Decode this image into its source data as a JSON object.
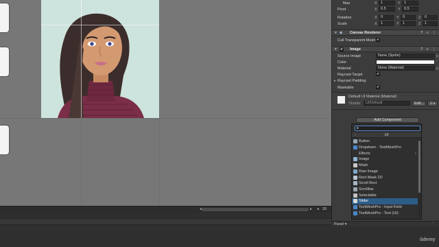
{
  "inspector": {
    "transform": {
      "max_label": "Max",
      "max_x_label": "X",
      "max_x": "1",
      "max_y_label": "Y",
      "max_y": "1",
      "pivot_label": "Pivot",
      "pivot_x_label": "X",
      "pivot_x": "0.5",
      "pivot_y_label": "Y",
      "pivot_y": "0.5",
      "rotation_label": "Rotation",
      "rot_x_label": "X",
      "rot_x": "0",
      "rot_y_label": "Y",
      "rot_y": "0",
      "rot_z_label": "Z",
      "rot_z": "0",
      "scale_label": "Scale",
      "scale_x_label": "X",
      "scale_x": "1",
      "scale_y_label": "Y",
      "scale_y": "1",
      "scale_z_label": "Z",
      "scale_z": "1"
    },
    "canvas_renderer": {
      "title": "Canvas Renderer",
      "cull_label": "Cull Transparent Mesh",
      "cull_check": "✔"
    },
    "image": {
      "title": "Image",
      "source_label": "Source Image",
      "source_value": "None (Sprite)",
      "color_label": "Color",
      "material_label": "Material",
      "material_value": "None (Material)",
      "raycast_target_label": "Raycast Target",
      "raycast_target_check": "✔",
      "raycast_padding_label": "Raycast Padding",
      "maskable_label": "Maskable",
      "maskable_check": "✔"
    },
    "material_section": {
      "name": "Default UI Material (Material)",
      "shader_label": "Shader",
      "shader_value": "UI/Default",
      "edit_label": "Edit...",
      "menu_label": "☰ ▾"
    },
    "add_component_label": "Add Component",
    "popup": {
      "search_value": "s",
      "title": "UI",
      "items": [
        {
          "label": "Button",
          "icon": "button-icon",
          "color": "#9aa7b4"
        },
        {
          "label": "Dropdown - TextMeshPro",
          "icon": "dropdown-icon",
          "color": "#4a86c8"
        },
        {
          "label": "Effects",
          "icon": "",
          "color": "",
          "arrow": "›"
        },
        {
          "label": "Image",
          "icon": "image-icon",
          "color": "#8fb4d6"
        },
        {
          "label": "Mask",
          "icon": "mask-icon",
          "color": "#c9c9c9"
        },
        {
          "label": "Raw Image",
          "icon": "raw-image-icon",
          "color": "#7fa8c8"
        },
        {
          "label": "Rect Mask 2D",
          "icon": "rect-mask-icon",
          "color": "#b9c7d4"
        },
        {
          "label": "Scroll Rect",
          "icon": "scroll-rect-icon",
          "color": "#aab6c2"
        },
        {
          "label": "Scrollbar",
          "icon": "scrollbar-icon",
          "color": "#9aa7b4"
        },
        {
          "label": "Selectable",
          "icon": "selectable-icon",
          "color": "#c2c2c2"
        },
        {
          "label": "Slider",
          "icon": "slider-icon",
          "color": "#d8d8d8",
          "selected": true
        },
        {
          "label": "TextMeshPro - Input Field",
          "icon": "input-field-icon",
          "color": "#4a86c8"
        },
        {
          "label": "TextMeshPro - Text (UI)",
          "icon": "tmp-text-icon",
          "color": "#4a86c8"
        }
      ]
    }
  },
  "scene": {
    "zoom_value": "20",
    "panel_label": "Panel ▾"
  },
  "colors": {
    "selection": "#2c5d87",
    "search_border": "#5a86c9",
    "image_background": "#cde3dd",
    "sweater": "#7b2e48"
  }
}
